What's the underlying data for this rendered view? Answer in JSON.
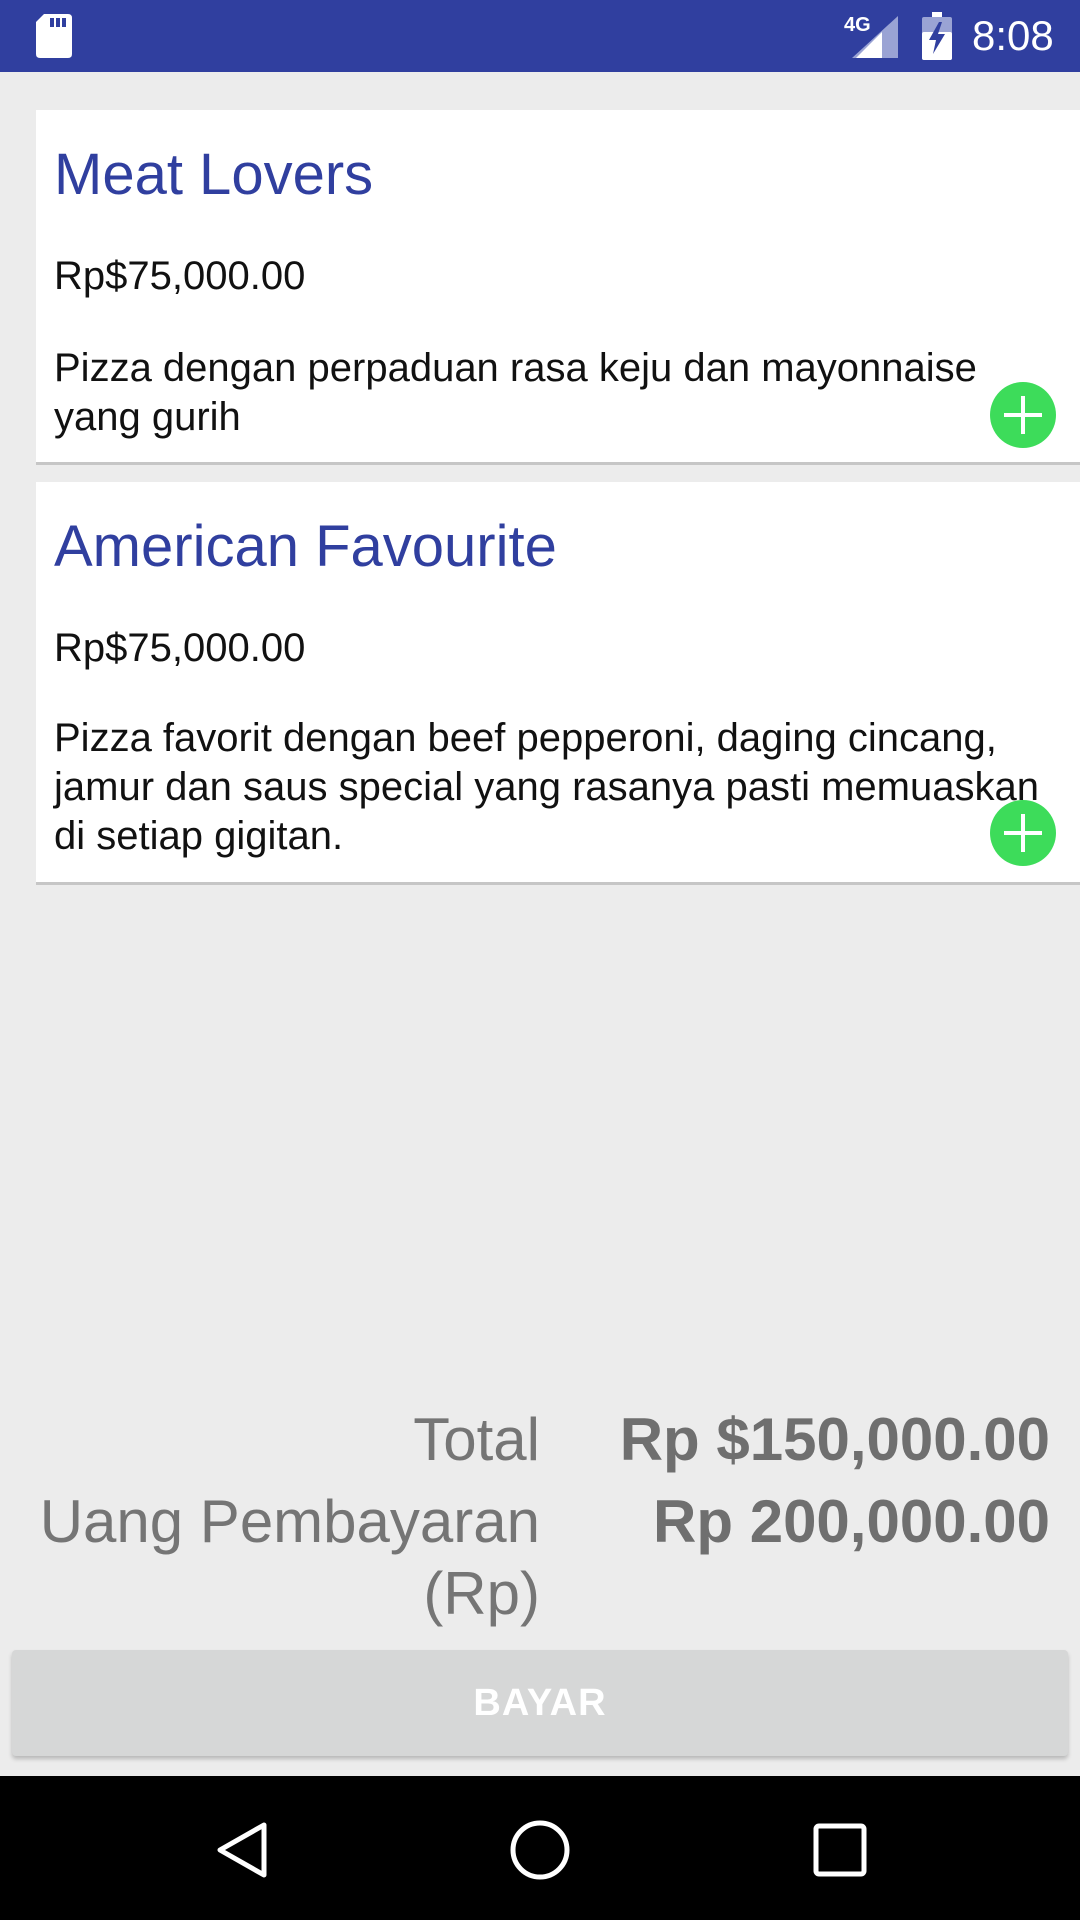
{
  "status_bar": {
    "network": "4G",
    "time": "8:08",
    "icons": [
      "sd-card-icon",
      "signal-icon",
      "battery-charging-icon"
    ]
  },
  "menu": {
    "items": [
      {
        "name": "Meat Lovers",
        "price": "Rp$75,000.00",
        "description": "Pizza dengan perpaduan rasa keju dan mayonnaise yang gurih",
        "add_icon": "add-circle-icon"
      },
      {
        "name": "American Favourite",
        "price": "Rp$75,000.00",
        "description": "Pizza favorit dengan beef pepperoni, daging cincang, jamur dan saus special yang rasanya pasti memuaskan di setiap gigitan.",
        "add_icon": "add-circle-icon"
      }
    ]
  },
  "summary": {
    "total_label": "Total",
    "total_value": "Rp $150,000.00",
    "payment_label": "Uang Pembayaran (Rp)",
    "payment_value": "Rp 200,000.00"
  },
  "actions": {
    "pay_label": "BAYAR"
  },
  "nav_bar": {
    "icons": [
      "back-icon",
      "home-icon",
      "recent-apps-icon"
    ]
  },
  "colors": {
    "primary": "#303f9f",
    "accent_add": "#3ddc5a",
    "background": "#ececec",
    "button_disabled": "#d6d7d7"
  }
}
